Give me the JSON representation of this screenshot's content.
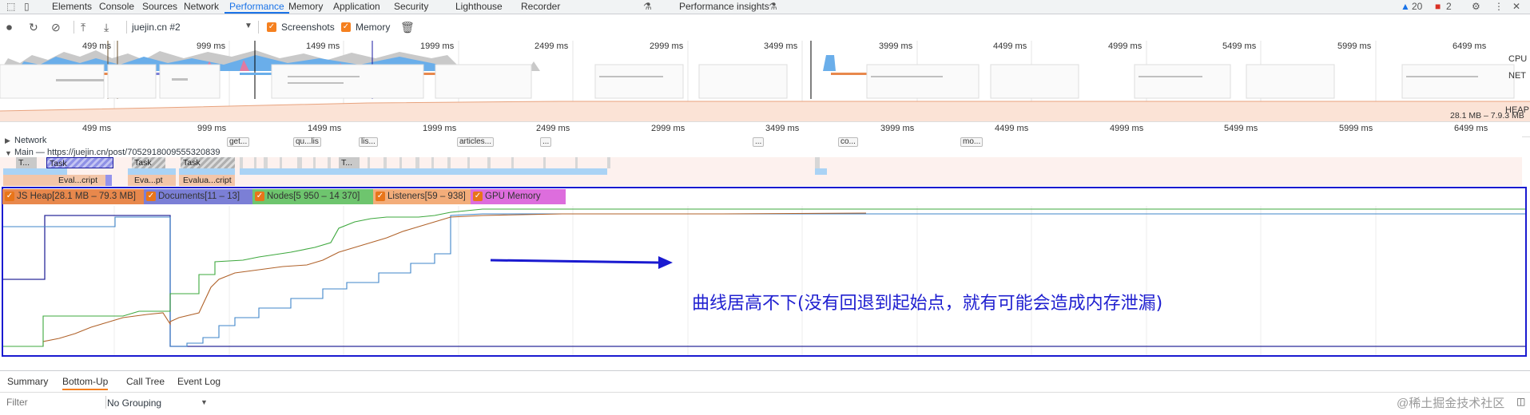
{
  "tabs": {
    "items": [
      "Elements",
      "Console",
      "Sources",
      "Network",
      "Performance",
      "Memory",
      "Application",
      "Security",
      "Lighthouse",
      "Recorder",
      "Performance insights"
    ],
    "active": "Performance",
    "warnings_count": "20",
    "errors_count": "2"
  },
  "toolbar": {
    "target": "juejin.cn #2",
    "screenshots_label": "Screenshots",
    "memory_label": "Memory"
  },
  "overview": {
    "ticks": [
      "499 ms",
      "999 ms",
      "1499 ms",
      "1999 ms",
      "2499 ms",
      "2999 ms",
      "3499 ms",
      "3999 ms",
      "4499 ms",
      "4999 ms",
      "5499 ms",
      "5999 ms",
      "6499 ms"
    ],
    "cpu_label": "CPU",
    "net_label": "NET",
    "heap_label": "HEAP",
    "heap_range": "28.1 MB – 7.9.3 MB"
  },
  "timeline": {
    "network_label": "Network",
    "main_label": "Main — https://juejin.cn/post/7052918009555320839",
    "network_flags": [
      "get...",
      "qu...lis",
      "lis...",
      "articles...",
      "...",
      "...",
      "co...",
      "mo..."
    ],
    "task_labels": [
      "T...",
      "Task",
      "Task",
      "Task",
      "T..."
    ],
    "eval_labels": [
      "Eval...cript",
      "Eva...pt",
      "Evalua...cript"
    ]
  },
  "memory": {
    "legend": [
      {
        "label": "JS Heap[28.1 MB – 79.3 MB]",
        "color": "#e8884c"
      },
      {
        "label": "Documents[11 – 13]",
        "color": "#7b7fd6"
      },
      {
        "label": "Nodes[5 950 – 14 370]",
        "color": "#6ec56e"
      },
      {
        "label": "Listeners[59 – 938]",
        "color": "#f3ad7a"
      },
      {
        "label": "GPU Memory",
        "color": "#dd6ddd"
      }
    ],
    "annotation": "曲线居高不下(没有回退到起始点，就有可能会造成内存泄漏)"
  },
  "bottom": {
    "tabs": [
      "Summary",
      "Bottom-Up",
      "Call Tree",
      "Event Log"
    ],
    "active": "Bottom-Up",
    "filter_placeholder": "Filter",
    "grouping": "No Grouping"
  },
  "watermark": "@稀土掘金技术社区"
}
